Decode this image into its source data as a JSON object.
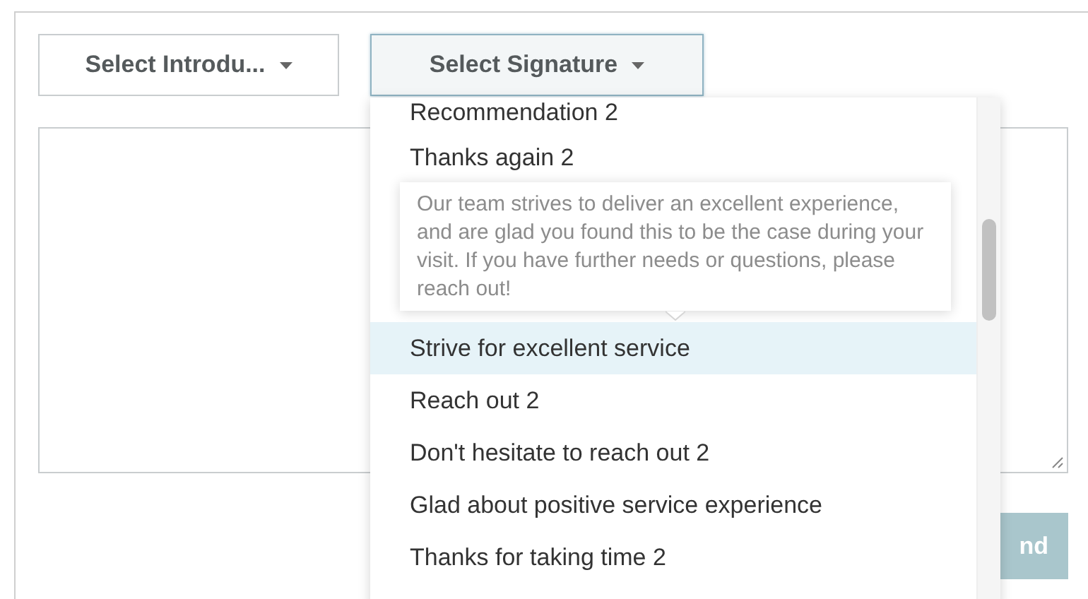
{
  "intro_dropdown": {
    "label": "Select Introdu...",
    "expanded": false
  },
  "signature_dropdown": {
    "label": "Select Signature",
    "expanded": true
  },
  "signature_menu": {
    "items": [
      {
        "label": "Recommendation 2",
        "selected": false
      },
      {
        "label": "Thanks again 2",
        "selected": false
      },
      {
        "label": "Strive for excellent service",
        "selected": true
      },
      {
        "label": "Reach out 2",
        "selected": false
      },
      {
        "label": "Don't hesitate to reach out 2",
        "selected": false
      },
      {
        "label": "Glad about positive service experience",
        "selected": false
      },
      {
        "label": "Thanks for taking time 2",
        "selected": false
      }
    ],
    "tooltip": {
      "text": "Our team strives to deliver an excellent experience, and are glad you found this to be the case during your visit. If you have further needs or questions, please reach out!"
    }
  },
  "send_button": {
    "label": "nd",
    "disabled": true
  }
}
